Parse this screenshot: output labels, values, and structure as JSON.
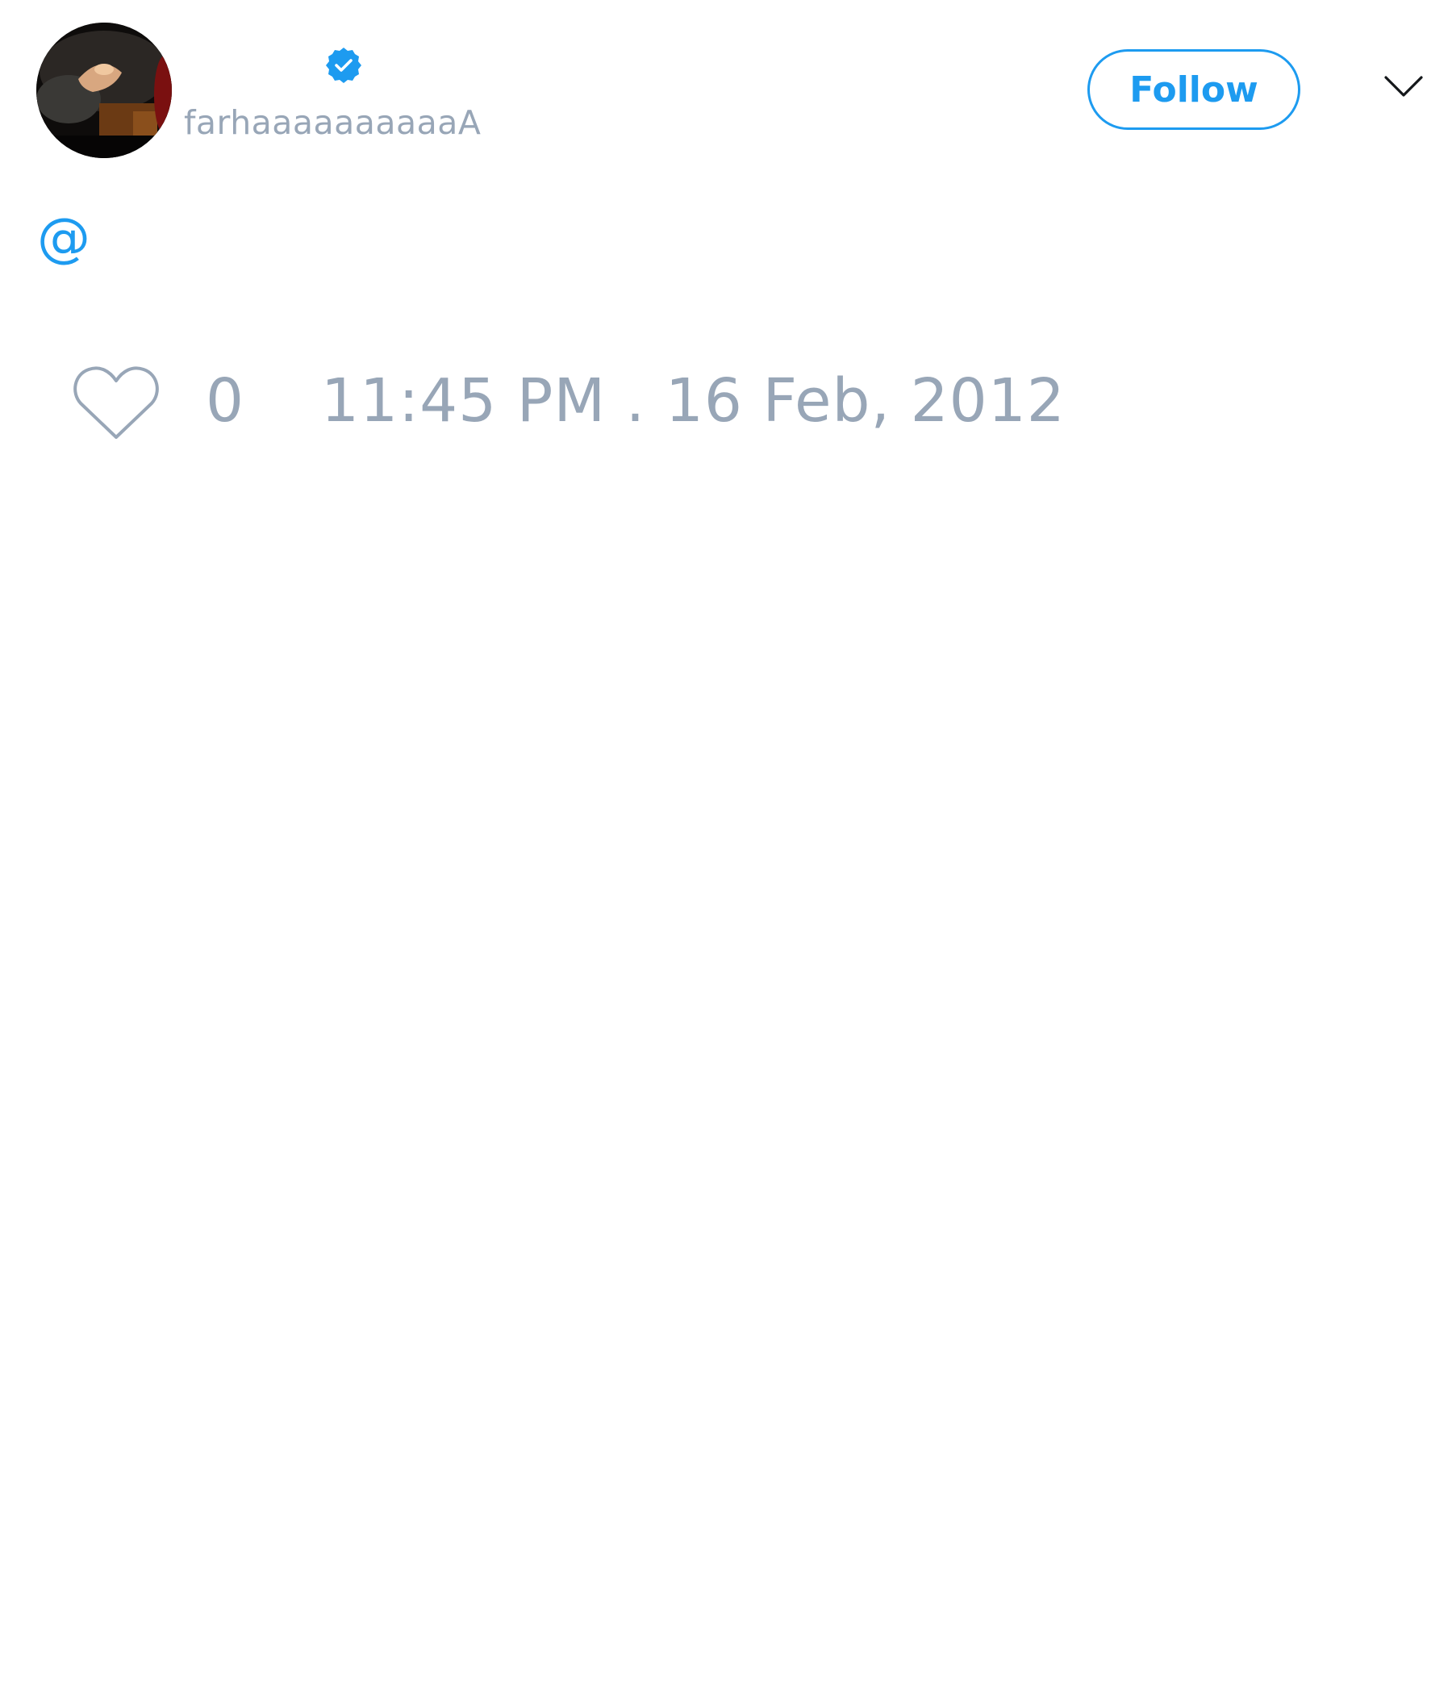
{
  "user": {
    "display_name": "",
    "username": "farhaaaaaaaaaaA",
    "verified": true,
    "avatar": "profile-photo"
  },
  "actions": {
    "follow_label": "Follow",
    "menu_icon": "chevron-down-icon"
  },
  "tweet": {
    "text": "@",
    "like_icon": "heart-outline-icon",
    "like_count": "0",
    "timestamp": "11:45 PM . 16 Feb, 2012"
  },
  "colors": {
    "accent": "#1d9bf0",
    "muted_text": "#98a6b7",
    "background": "#ffffff"
  }
}
